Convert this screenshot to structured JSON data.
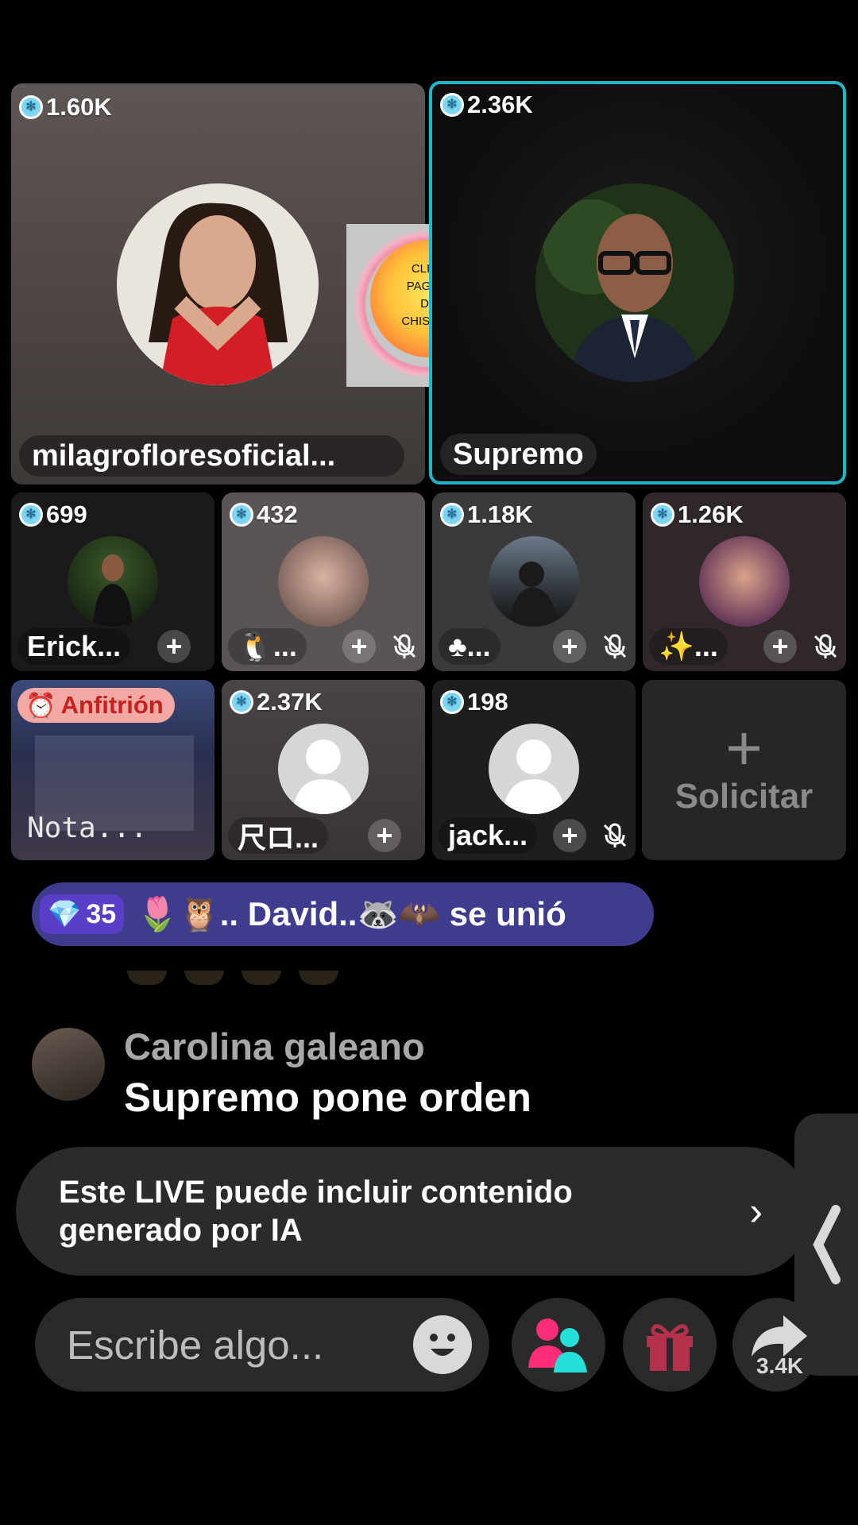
{
  "hosts": [
    {
      "score": "1.60K",
      "name": "milagrofloresoficial..."
    },
    {
      "score": "2.36K",
      "name": "Supremo"
    }
  ],
  "overlay_logo": {
    "line1": "CLIPS",
    "line2": "PAGINA",
    "line3": "DE",
    "line4": "CHISMES"
  },
  "guests": [
    {
      "score": "699",
      "name": "Erick..."
    },
    {
      "score": "432",
      "name": "🐧..."
    },
    {
      "score": "1.18K",
      "name": "♣..."
    },
    {
      "score": "1.26K",
      "name": "✨..."
    },
    {
      "host_label": "Anfitrión",
      "name": "Nota..."
    },
    {
      "score": "2.37K",
      "name": "尺ロ..."
    },
    {
      "score": "198",
      "name": "jack..."
    }
  ],
  "request": {
    "label": "Solicitar"
  },
  "join_banner": {
    "level": "35",
    "text": "🌷🦉.. David..🦝🦇 se unió"
  },
  "comment": {
    "user": "Carolina galeano",
    "text": "Supremo pone orden"
  },
  "ai_notice": {
    "line1": "Este LIVE puede incluir contenido",
    "line2": "generado por IA"
  },
  "input": {
    "placeholder": "Escribe algo..."
  },
  "share_count": "3.4K",
  "colors": {
    "accent_frame": "#1fb6c8",
    "banner_bg": "#3f3c8f",
    "host_tag": "#f4a8a4",
    "gift": "#b5304a",
    "friends_pink": "#ff2d78",
    "friends_cyan": "#25e0d8"
  }
}
